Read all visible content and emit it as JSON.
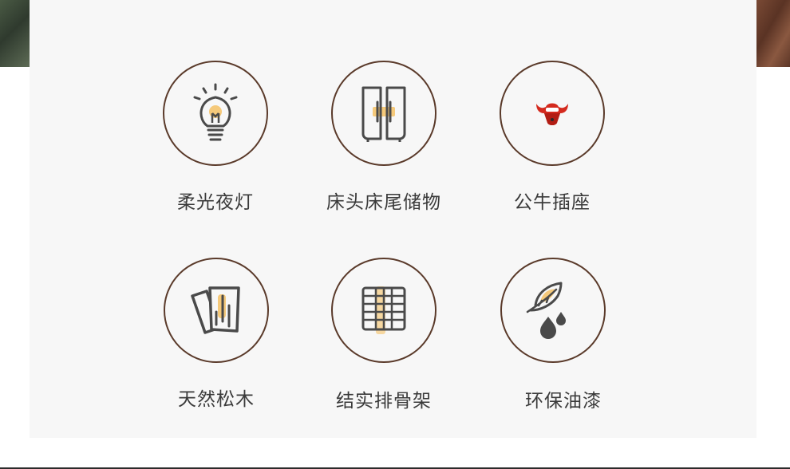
{
  "features": [
    {
      "label": "柔光夜灯",
      "icon": "lightbulb-icon"
    },
    {
      "label": "床头床尾储物",
      "icon": "cabinet-doors-icon"
    },
    {
      "label": "公牛插座",
      "icon": "bull-socket-icon"
    },
    {
      "label": "天然松木",
      "icon": "wood-planks-icon"
    },
    {
      "label": "结实排骨架",
      "icon": "slat-frame-icon"
    },
    {
      "label": "环保油漆",
      "icon": "leaf-paint-icon"
    }
  ],
  "colors": {
    "circle_border": "#5a3a2a",
    "icon_stroke": "#4a4a4a",
    "accent_highlight": "#f5c97a",
    "bull_red": "#d42a1e",
    "panel_bg": "#f7f7f7"
  }
}
